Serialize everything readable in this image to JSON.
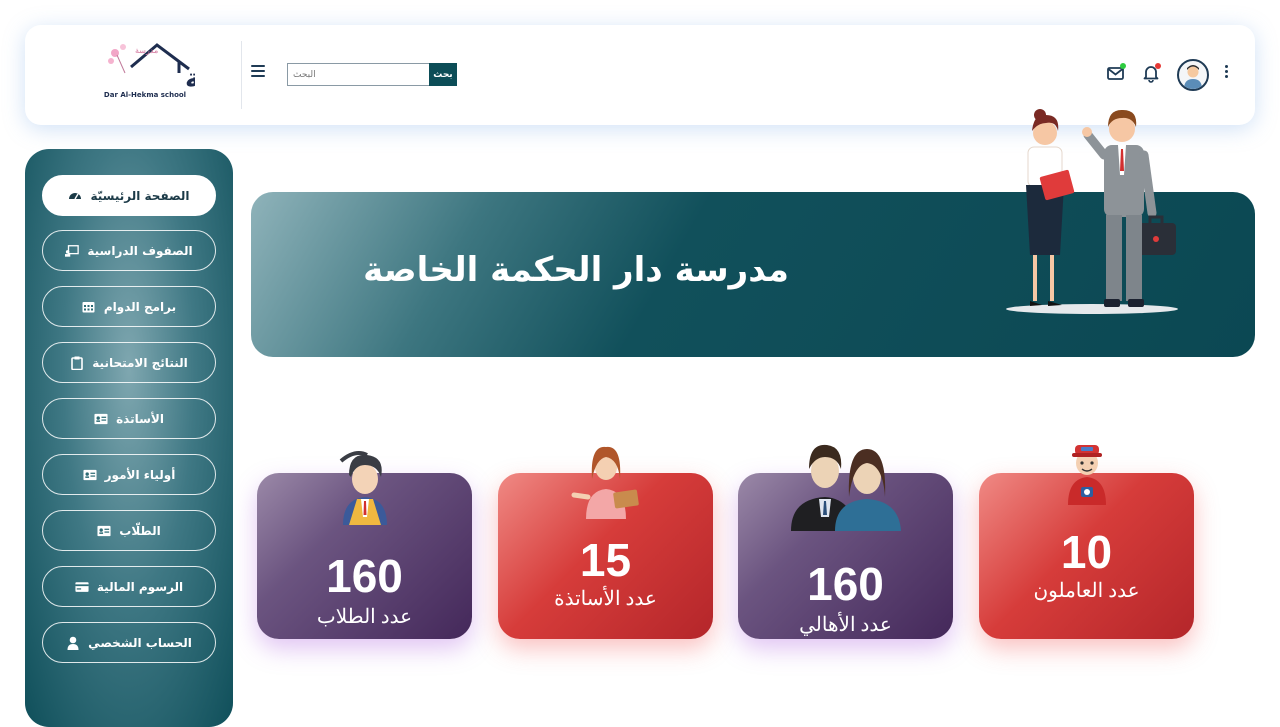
{
  "header": {
    "logo_caption": "Dar Al-Hekma school",
    "search_placeholder": "البحث",
    "search_button": "بحث",
    "icons": [
      "mail-icon",
      "bell-icon",
      "user-avatar",
      "kebab-icon"
    ],
    "status_colors": {
      "mail_dot": "#2ecc40",
      "bell_dot": "#e53935"
    }
  },
  "sidebar": {
    "items": [
      {
        "label": "الصفحة الرئيسيّة",
        "icon": "dashboard-icon",
        "active": true
      },
      {
        "label": "الصفوف الدراسية",
        "icon": "classroom-icon",
        "active": false
      },
      {
        "label": "برامج الدوام",
        "icon": "calendar-icon",
        "active": false
      },
      {
        "label": "النتائج الامتحانية",
        "icon": "clipboard-icon",
        "active": false
      },
      {
        "label": "الأساتذة",
        "icon": "id-card-icon",
        "active": false
      },
      {
        "label": "أولياء الأمور",
        "icon": "id-card-icon",
        "active": false
      },
      {
        "label": "الطلّاب",
        "icon": "id-card-icon",
        "active": false
      },
      {
        "label": "الرسوم المالية",
        "icon": "money-card-icon",
        "active": false
      },
      {
        "label": "الحساب الشخصي",
        "icon": "user-icon",
        "active": false
      }
    ]
  },
  "banner": {
    "title": "مدرسة دار الحكمة الخاصة"
  },
  "stats": [
    {
      "value": "160",
      "label": "عدد الطلاب",
      "icon": "student-graduate-icon"
    },
    {
      "value": "15",
      "label": "عدد الأساتذة",
      "icon": "teacher-icon"
    },
    {
      "value": "160",
      "label": "عدد الأهالي",
      "icon": "parents-icon"
    },
    {
      "value": "10",
      "label": "عدد العاملون",
      "icon": "worker-icon"
    }
  ]
}
